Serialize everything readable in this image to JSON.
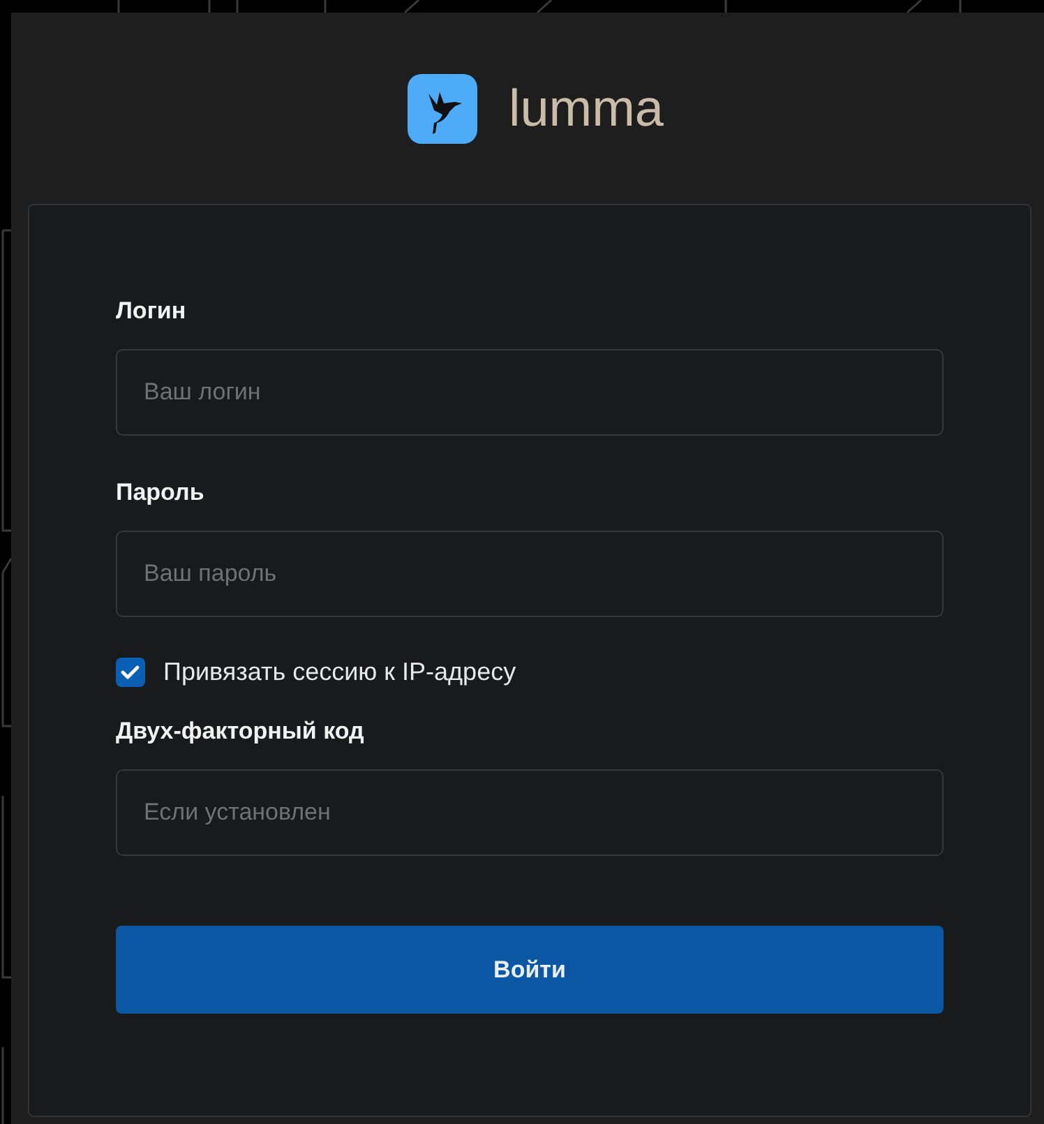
{
  "logo": {
    "name": "lumma"
  },
  "form": {
    "items": [
      {
        "kind": "field",
        "label": "Логин",
        "placeholder": "Ваш логин"
      },
      {
        "kind": "field",
        "label": "Пароль",
        "placeholder": "Ваш пароль"
      },
      {
        "kind": "checkbox",
        "label": "Привязать сессию к IP-адресу",
        "checked": true
      },
      {
        "kind": "field",
        "label": "Двух-факторный код",
        "placeholder": "Если установлен"
      }
    ],
    "submit": "Войти"
  }
}
